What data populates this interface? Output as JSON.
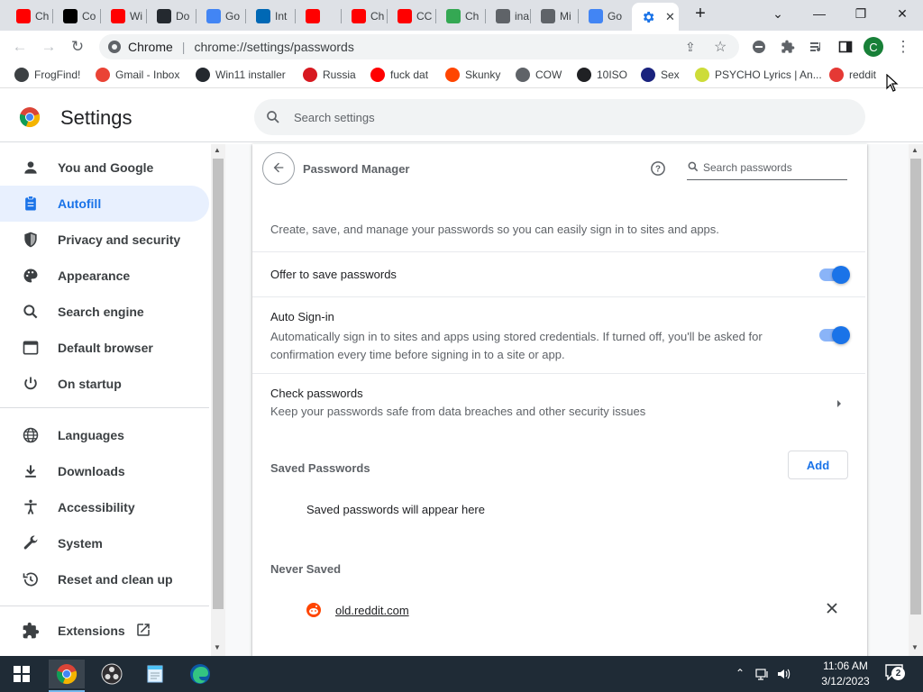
{
  "browser": {
    "tabs": [
      {
        "label": "Ch",
        "color": "#ff0000"
      },
      {
        "label": "Co",
        "color": "#000000"
      },
      {
        "label": "Wi",
        "color": "#ff0000"
      },
      {
        "label": "Do",
        "color": "#24292f"
      },
      {
        "label": "Go",
        "color": "#4285f4"
      },
      {
        "label": "Int",
        "color": "#0068b5"
      },
      {
        "label": "",
        "color": "#ff0000"
      },
      {
        "label": "Ch",
        "color": "#ff0000"
      },
      {
        "label": "CC",
        "color": "#ff0000"
      },
      {
        "label": "Ch",
        "color": "#34a853"
      },
      {
        "label": "ina",
        "color": "#5f6368"
      },
      {
        "label": "Mi",
        "color": "#5f6368"
      },
      {
        "label": "Go",
        "color": "#4285f4"
      }
    ],
    "active_tab_icon": "settings-gear-icon",
    "new_tab_symbol": "+",
    "window_controls": {
      "tab_search": "⌄",
      "minimize": "—",
      "maximize": "❐",
      "close": "✕"
    },
    "omnibox": {
      "site_label": "Chrome",
      "separator": "|",
      "url": "chrome://settings/passwords"
    },
    "profile_initial": "C",
    "profile_color": "#188038",
    "bookmarks": [
      {
        "label": "FrogFind!",
        "icon": "globe-icon",
        "color": "#3c4043"
      },
      {
        "label": "Gmail - Inbox",
        "icon": "gmail-icon",
        "color": "#ea4335"
      },
      {
        "label": "Win11 installer",
        "icon": "github-icon",
        "color": "#24292f"
      },
      {
        "label": "Russia",
        "icon": "flag-icon",
        "color": "#d71920"
      },
      {
        "label": "fuck dat",
        "icon": "youtube-icon",
        "color": "#ff0000"
      },
      {
        "label": "Skunky",
        "icon": "reddit-icon",
        "color": "#ff4500"
      },
      {
        "label": "COW",
        "icon": "globe-icon",
        "color": "#5f6368"
      },
      {
        "label": "10ISO",
        "icon": "building-icon",
        "color": "#202124"
      },
      {
        "label": "Sex",
        "icon": "s-logo-icon",
        "color": "#1a237e"
      },
      {
        "label": "PSYCHO Lyrics | An...",
        "icon": "loading-icon",
        "color": "#cddc39"
      },
      {
        "label": "reddit",
        "icon": "rainbow-icon",
        "color": "#e53935"
      }
    ]
  },
  "header": {
    "title": "Settings",
    "search_placeholder": "Search settings"
  },
  "sidebar": {
    "items": [
      {
        "label": "You and Google",
        "icon": "person-icon"
      },
      {
        "label": "Autofill",
        "icon": "clipboard-icon"
      },
      {
        "label": "Privacy and security",
        "icon": "shield-icon"
      },
      {
        "label": "Appearance",
        "icon": "palette-icon"
      },
      {
        "label": "Search engine",
        "icon": "search-icon"
      },
      {
        "label": "Default browser",
        "icon": "browser-icon"
      },
      {
        "label": "On startup",
        "icon": "power-icon"
      },
      {
        "label": "Languages",
        "icon": "globe-icon"
      },
      {
        "label": "Downloads",
        "icon": "download-icon"
      },
      {
        "label": "Accessibility",
        "icon": "accessibility-icon"
      },
      {
        "label": "System",
        "icon": "wrench-icon"
      },
      {
        "label": "Reset and clean up",
        "icon": "history-icon"
      }
    ],
    "extensions": {
      "label": "Extensions",
      "icon": "puzzle-icon",
      "link_icon": "open-in-new-icon"
    }
  },
  "password_manager": {
    "title": "Password Manager",
    "search_placeholder": "Search passwords",
    "description": "Create, save, and manage your passwords so you can easily sign in to sites and apps.",
    "offer_to_save": {
      "label": "Offer to save passwords",
      "enabled": true
    },
    "auto_signin": {
      "label": "Auto Sign-in",
      "description": "Automatically sign in to sites and apps using stored credentials. If turned off, you'll be asked for confirmation every time before signing in to a site or app.",
      "enabled": true
    },
    "check_passwords": {
      "label": "Check passwords",
      "description": "Keep your passwords safe from data breaches and other security issues"
    },
    "saved_passwords": {
      "label": "Saved Passwords",
      "add_label": "Add",
      "empty_text": "Saved passwords will appear here"
    },
    "never_saved": {
      "label": "Never Saved",
      "sites": [
        {
          "url": "old.reddit.com",
          "icon": "reddit-icon"
        }
      ]
    }
  },
  "colors": {
    "accent": "#1a73e8",
    "accent_light": "#e8f0fe",
    "toggle_track": "#8ab4f8"
  },
  "taskbar": {
    "apps": [
      {
        "name": "start-icon"
      },
      {
        "name": "chrome-icon"
      },
      {
        "name": "obs-icon"
      },
      {
        "name": "notepad-icon"
      },
      {
        "name": "edge-icon"
      }
    ],
    "time": "11:06 AM",
    "date": "3/12/2023",
    "notification_count": "2"
  }
}
